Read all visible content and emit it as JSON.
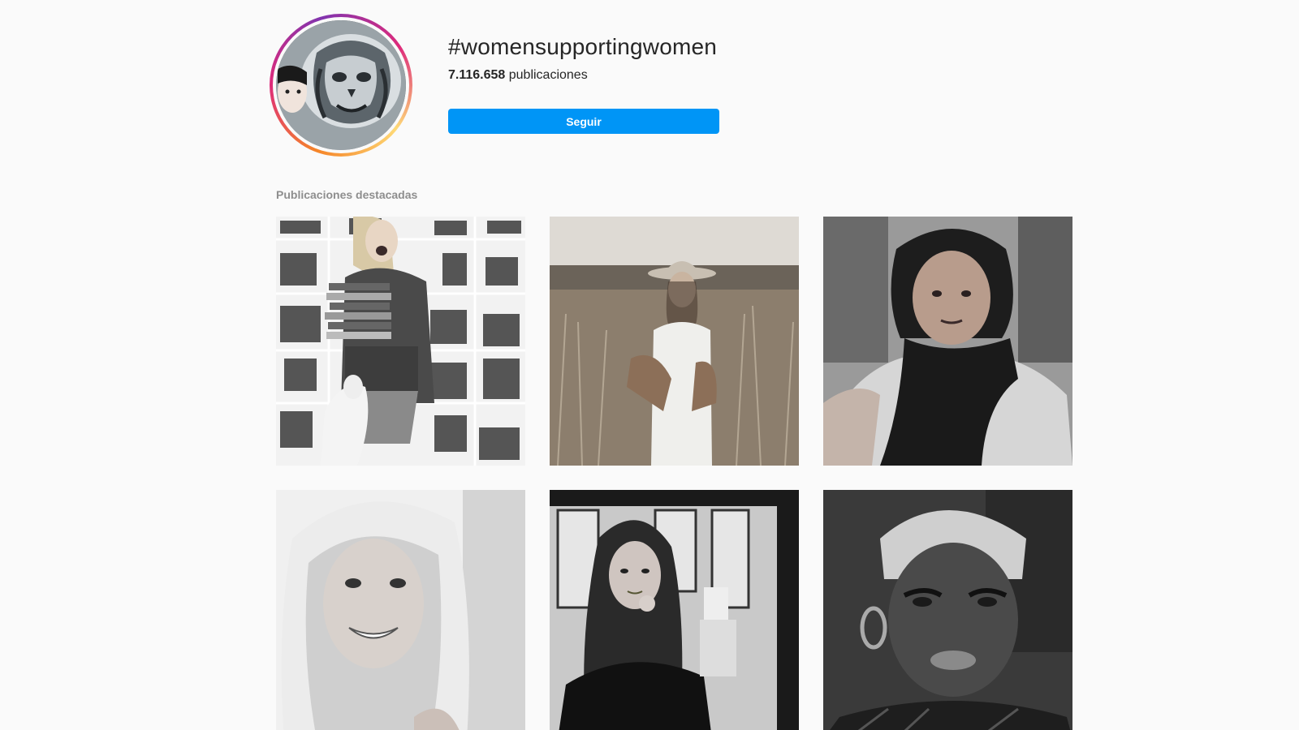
{
  "header": {
    "hashtag": "#womensupportingwomen",
    "post_count": "7.116.658",
    "post_count_label": "publicaciones",
    "follow_label": "Seguir",
    "follow_color": "#0095f6"
  },
  "featured": {
    "title": "Publicaciones destacadas",
    "posts": [
      {
        "icon": "post-woman-with-books-image"
      },
      {
        "icon": "post-woman-in-field-with-hat-image"
      },
      {
        "icon": "post-woman-with-scarf-selfie-image"
      },
      {
        "icon": "post-blonde-woman-smiling-image"
      },
      {
        "icon": "post-woman-in-salon-image"
      },
      {
        "icon": "post-woman-with-headwrap-image"
      }
    ]
  }
}
